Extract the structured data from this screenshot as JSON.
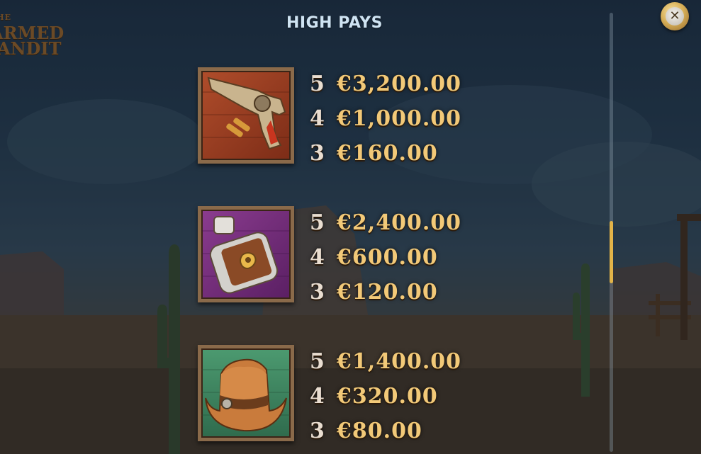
{
  "logo": {
    "line1": "THE",
    "line2": "ARMED",
    "line3": "ANDIT"
  },
  "title": "HIGH PAYS",
  "close_button": {
    "icon": "close-icon",
    "glyph": "✕"
  },
  "colors": {
    "title": "#cfe3f2",
    "amount": "#f2c978",
    "count": "#e9ddd0",
    "scroll_thumb": "#e2b348"
  },
  "symbols": [
    {
      "name": "revolver",
      "icon": "revolver-icon",
      "pays": [
        {
          "count": "5",
          "amount": "€3,200.00"
        },
        {
          "count": "4",
          "amount": "€1,000.00"
        },
        {
          "count": "3",
          "amount": "€160.00"
        }
      ]
    },
    {
      "name": "flask",
      "icon": "flask-icon",
      "pays": [
        {
          "count": "5",
          "amount": "€2,400.00"
        },
        {
          "count": "4",
          "amount": "€600.00"
        },
        {
          "count": "3",
          "amount": "€120.00"
        }
      ]
    },
    {
      "name": "cowboy-hat",
      "icon": "cowboy-hat-icon",
      "pays": [
        {
          "count": "5",
          "amount": "€1,400.00"
        },
        {
          "count": "4",
          "amount": "€320.00"
        },
        {
          "count": "3",
          "amount": "€80.00"
        }
      ]
    }
  ]
}
